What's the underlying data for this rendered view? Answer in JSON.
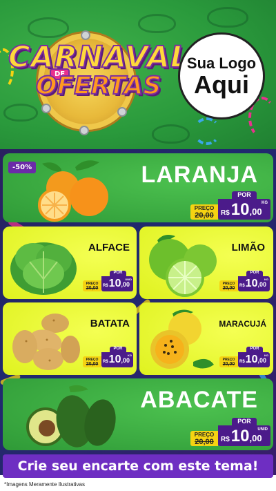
{
  "header": {
    "title_line1": "CARNAVAL",
    "title_de": "DE",
    "title_line2": "OFERTAS",
    "logo_line1": "Sua Logo",
    "logo_line2": "Aqui"
  },
  "products": {
    "laranja": {
      "name": "LARANJA",
      "badge": "-50%",
      "preco_label": "PREÇO",
      "old_price": "20,00",
      "por_label": "POR",
      "currency": "R$",
      "price_int": "10",
      "price_dec": ",00",
      "unit": "KG"
    },
    "alface": {
      "name": "ALFACE",
      "preco_label": "PREÇO",
      "old_price": "20,00",
      "por_label": "POR",
      "currency": "R$",
      "price_int": "10",
      "price_dec": ",00",
      "unit": "UNID"
    },
    "limao": {
      "name": "LIMÃO",
      "preco_label": "PREÇO",
      "old_price": "20,00",
      "por_label": "POR",
      "currency": "R$",
      "price_int": "10",
      "price_dec": ",00",
      "unit": "KG"
    },
    "batata": {
      "name": "BATATA",
      "preco_label": "PREÇO",
      "old_price": "20,00",
      "por_label": "POR",
      "currency": "R$",
      "price_int": "10",
      "price_dec": ",00",
      "unit": "KG"
    },
    "maracuja": {
      "name": "MARACUJÁ",
      "preco_label": "PREÇO",
      "old_price": "20,00",
      "por_label": "POR",
      "currency": "R$",
      "price_int": "10",
      "price_dec": ",00",
      "unit": "KG"
    },
    "abacate": {
      "name": "ABACATE",
      "preco_label": "PREÇO",
      "old_price": "20,00",
      "por_label": "POR",
      "currency": "R$",
      "price_int": "10",
      "price_dec": ",00",
      "unit": "UNID"
    }
  },
  "cta": "Crie seu encarte com este tema!",
  "footnote": "*Imagens Meramente Ilustrativas",
  "colors": {
    "green": "#2f9a37",
    "yellow": "#e4f526",
    "purple": "#4b1b8a",
    "gold": "#f5d312"
  }
}
